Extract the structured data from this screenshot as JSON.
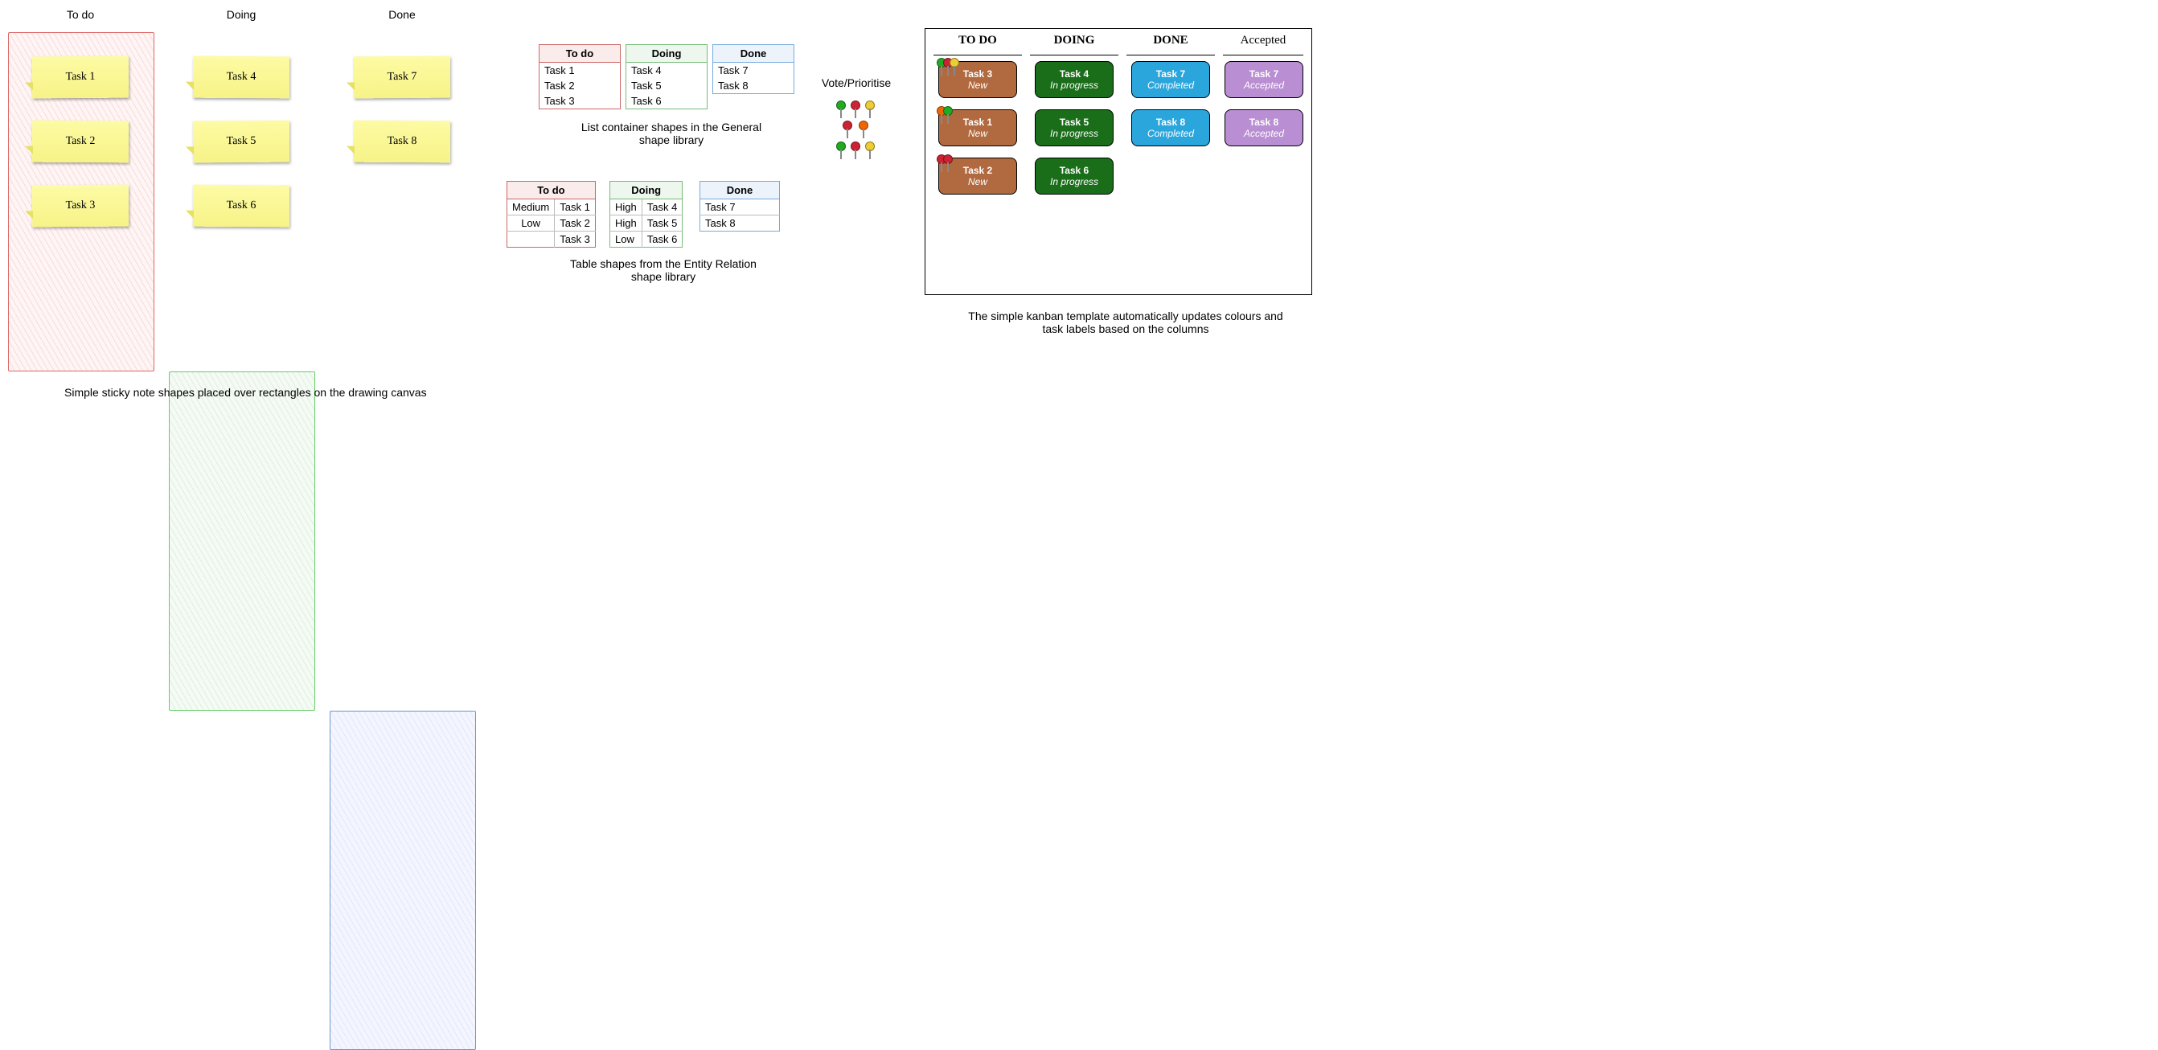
{
  "sticky_board": {
    "columns": [
      "To do",
      "Doing",
      "Done"
    ],
    "tasks": {
      "todo": [
        "Task 1",
        "Task 2",
        "Task 3"
      ],
      "doing": [
        "Task 4",
        "Task 5",
        "Task 6"
      ],
      "done": [
        "Task 7",
        "Task 8"
      ]
    },
    "caption": "Simple sticky note shapes placed over rectangles on the drawing canvas"
  },
  "list_shapes": {
    "columns": [
      {
        "header": "To do",
        "items": [
          "Task 1",
          "Task 2",
          "Task 3"
        ]
      },
      {
        "header": "Doing",
        "items": [
          "Task 4",
          "Task 5",
          "Task 6"
        ]
      },
      {
        "header": "Done",
        "items": [
          "Task 7",
          "Task 8"
        ]
      }
    ],
    "caption": "List container shapes in the General shape library"
  },
  "table_shapes": {
    "columns": [
      {
        "header": "To do",
        "rows": [
          [
            "Medium",
            "Task 1"
          ],
          [
            "Low",
            "Task 2"
          ],
          [
            "",
            "Task 3"
          ]
        ]
      },
      {
        "header": "Doing",
        "rows": [
          [
            "High",
            "Task 4"
          ],
          [
            "High",
            "Task 5"
          ],
          [
            "Low",
            "Task 6"
          ]
        ]
      },
      {
        "header": "Done",
        "rows": [
          [
            "Task 7"
          ],
          [
            "Task 8"
          ]
        ]
      }
    ],
    "caption": "Table shapes from the Entity Relation shape library"
  },
  "vote": {
    "label": "Vote/Prioritise"
  },
  "template_board": {
    "headers": [
      "TO DO",
      "DOING",
      "DONE",
      "Accepted"
    ],
    "cols": {
      "todo": [
        {
          "t": "Task 3",
          "s": "New"
        },
        {
          "t": "Task 1",
          "s": "New"
        },
        {
          "t": "Task 2",
          "s": "New"
        }
      ],
      "doing": [
        {
          "t": "Task 4",
          "s": "In progress"
        },
        {
          "t": "Task 5",
          "s": "In progress"
        },
        {
          "t": "Task 6",
          "s": "In progress"
        }
      ],
      "done": [
        {
          "t": "Task 7",
          "s": "Completed"
        },
        {
          "t": "Task 8",
          "s": "Completed"
        }
      ],
      "accepted": [
        {
          "t": "Task 7",
          "s": "Accepted"
        },
        {
          "t": "Task 8",
          "s": "Accepted"
        }
      ]
    },
    "caption": "The simple kanban template automatically updates colours and task labels based on the columns"
  }
}
